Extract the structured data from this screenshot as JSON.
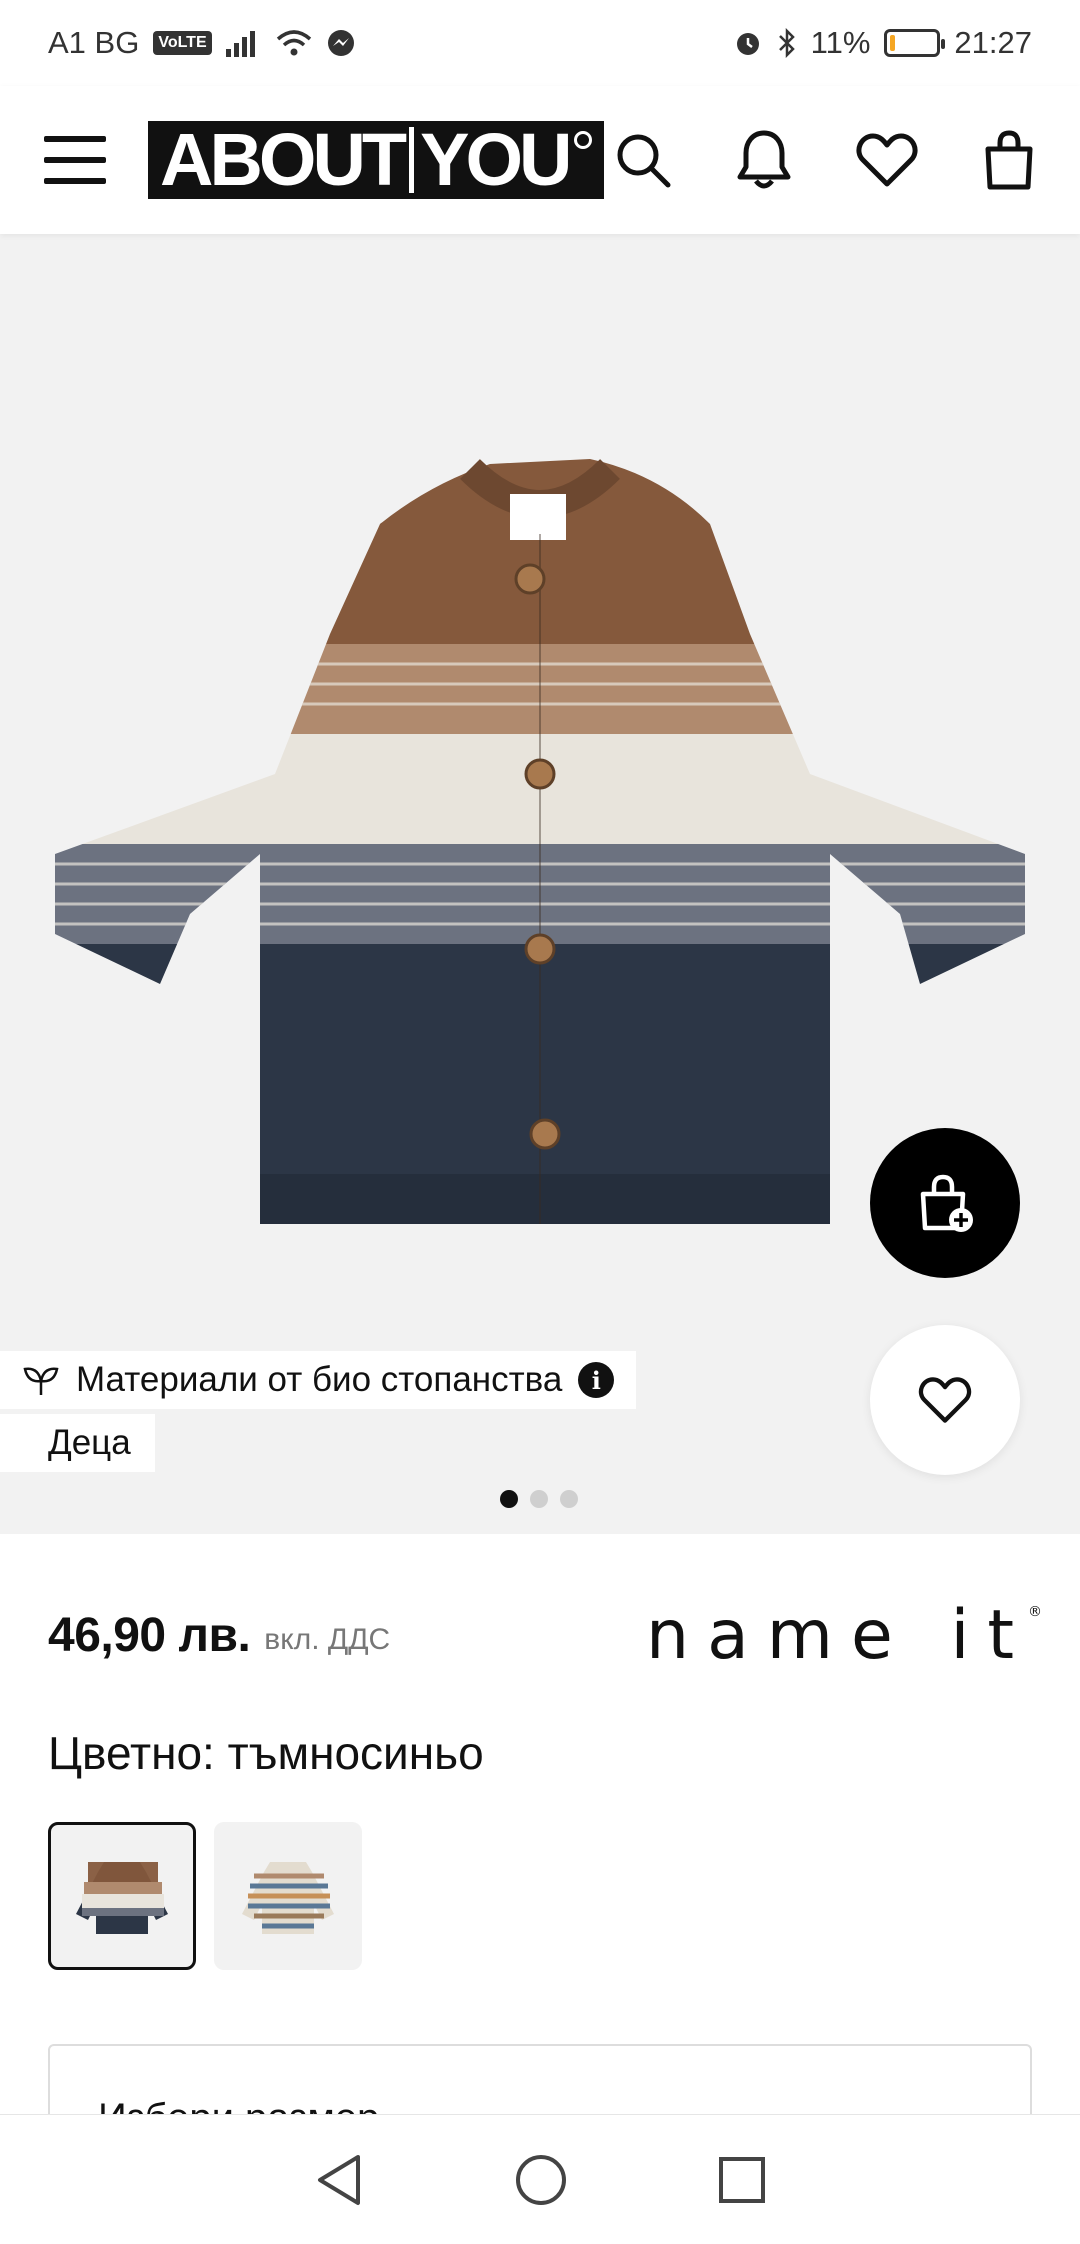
{
  "status_bar": {
    "carrier": "A1 BG",
    "volte": "VoLTE",
    "battery": "11%",
    "battery_level": 0.11,
    "time": "21:27"
  },
  "header": {
    "logo_left": "ABOUT",
    "logo_right": "YOU",
    "icons": [
      "menu-icon",
      "search-icon",
      "bell-icon",
      "heart-icon",
      "bag-icon"
    ]
  },
  "gallery": {
    "image_alt": "knitted striped cardigan",
    "badge_bio": "Материали от био стопанства",
    "badge_kids": "Деца",
    "dots_total": 3,
    "dots_active": 1
  },
  "product": {
    "price": "46,90 лв.",
    "vat": "вкл. ДДС",
    "brand": "name it",
    "color_label": "Цветно: тъмносиньо",
    "size_label": "Избери размер"
  },
  "colors": {
    "brown": "#85593c",
    "cream": "#e8e4dc",
    "navy": "#2c3646",
    "gallery_bg": "#f2f2f2"
  }
}
